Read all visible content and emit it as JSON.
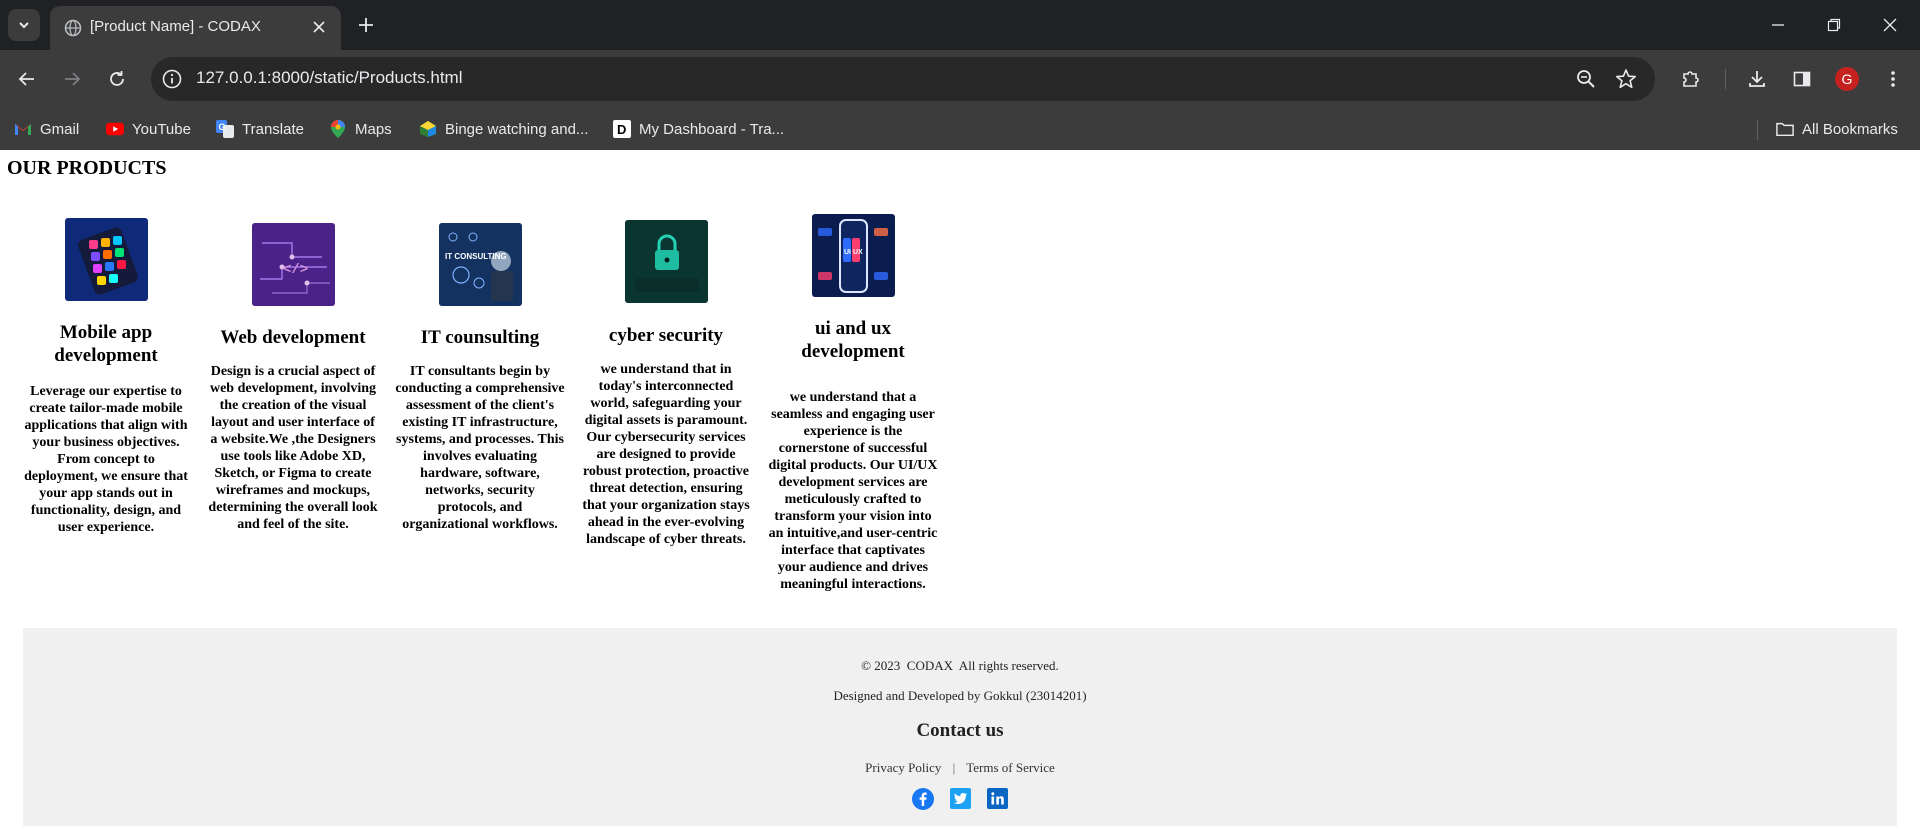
{
  "browser": {
    "tab_title": "[Product Name] - CODAX",
    "url": "127.0.0.1:8000/static/Products.html",
    "profile_initial": "G",
    "bookmarks": [
      {
        "label": "Gmail",
        "icon": "gmail-icon"
      },
      {
        "label": "YouTube",
        "icon": "youtube-icon"
      },
      {
        "label": "Translate",
        "icon": "translate-icon"
      },
      {
        "label": "Maps",
        "icon": "maps-icon"
      },
      {
        "label": "Binge watching and...",
        "icon": "binge-icon"
      },
      {
        "label": "My Dashboard - Tra...",
        "icon": "dashboard-icon"
      }
    ],
    "all_bookmarks_label": "All Bookmarks"
  },
  "page": {
    "title": "OUR PRODUCTS",
    "products": [
      {
        "name": "Mobile app development",
        "image_icon": "mobile-app-image",
        "description": "Leverage our expertise to create tailor-made mobile applications that align with your business objectives. From concept to deployment, we ensure that your app stands out in functionality, design, and user experience."
      },
      {
        "name": "Web development",
        "image_icon": "web-development-image",
        "description": "Design is a crucial aspect of web development, involving the creation of the visual layout and user interface of a website.We ,the Designers use tools like Adobe XD, Sketch, or Figma to create wireframes and mockups, determining the overall look and feel of the site."
      },
      {
        "name": "IT counsulting",
        "image_icon": "it-consulting-image",
        "description": "IT consultants begin by conducting a comprehensive assessment of the client's existing IT infrastructure, systems, and processes. This involves evaluating hardware, software, networks, security protocols, and organizational workflows."
      },
      {
        "name": "cyber security",
        "image_icon": "cyber-security-image",
        "description": "we understand that in today's interconnected world, safeguarding your digital assets is paramount. Our cybersecurity services are designed to provide robust protection, proactive threat detection, ensuring that your organization stays ahead in the ever-evolving landscape of cyber threats."
      },
      {
        "name": "ui and ux development",
        "image_icon": "ui-ux-image",
        "description": "we understand that a seamless and engaging user experience is the cornerstone of successful digital products. Our UI/UX development services are meticulously crafted to transform your vision into an intuitive,and user-centric interface that captivates your audience and drives meaningful interactions."
      }
    ]
  },
  "footer": {
    "copyright": "© 2023  CODAX  All rights reserved.",
    "credit": "Designed and Developed by Gokkul (23014201)",
    "contact_heading": "Contact us",
    "privacy": "Privacy Policy",
    "separator": "|",
    "terms": "Terms of Service",
    "social": [
      "facebook-icon",
      "twitter-icon",
      "linkedin-icon"
    ]
  },
  "colors": {
    "chrome_dark": "#202124",
    "chrome_toolbar": "#3c3c3c",
    "footer_bg": "#f0f0f0",
    "facebook": "#1877f2",
    "twitter": "#1da1f2",
    "linkedin": "#0a66c2"
  }
}
